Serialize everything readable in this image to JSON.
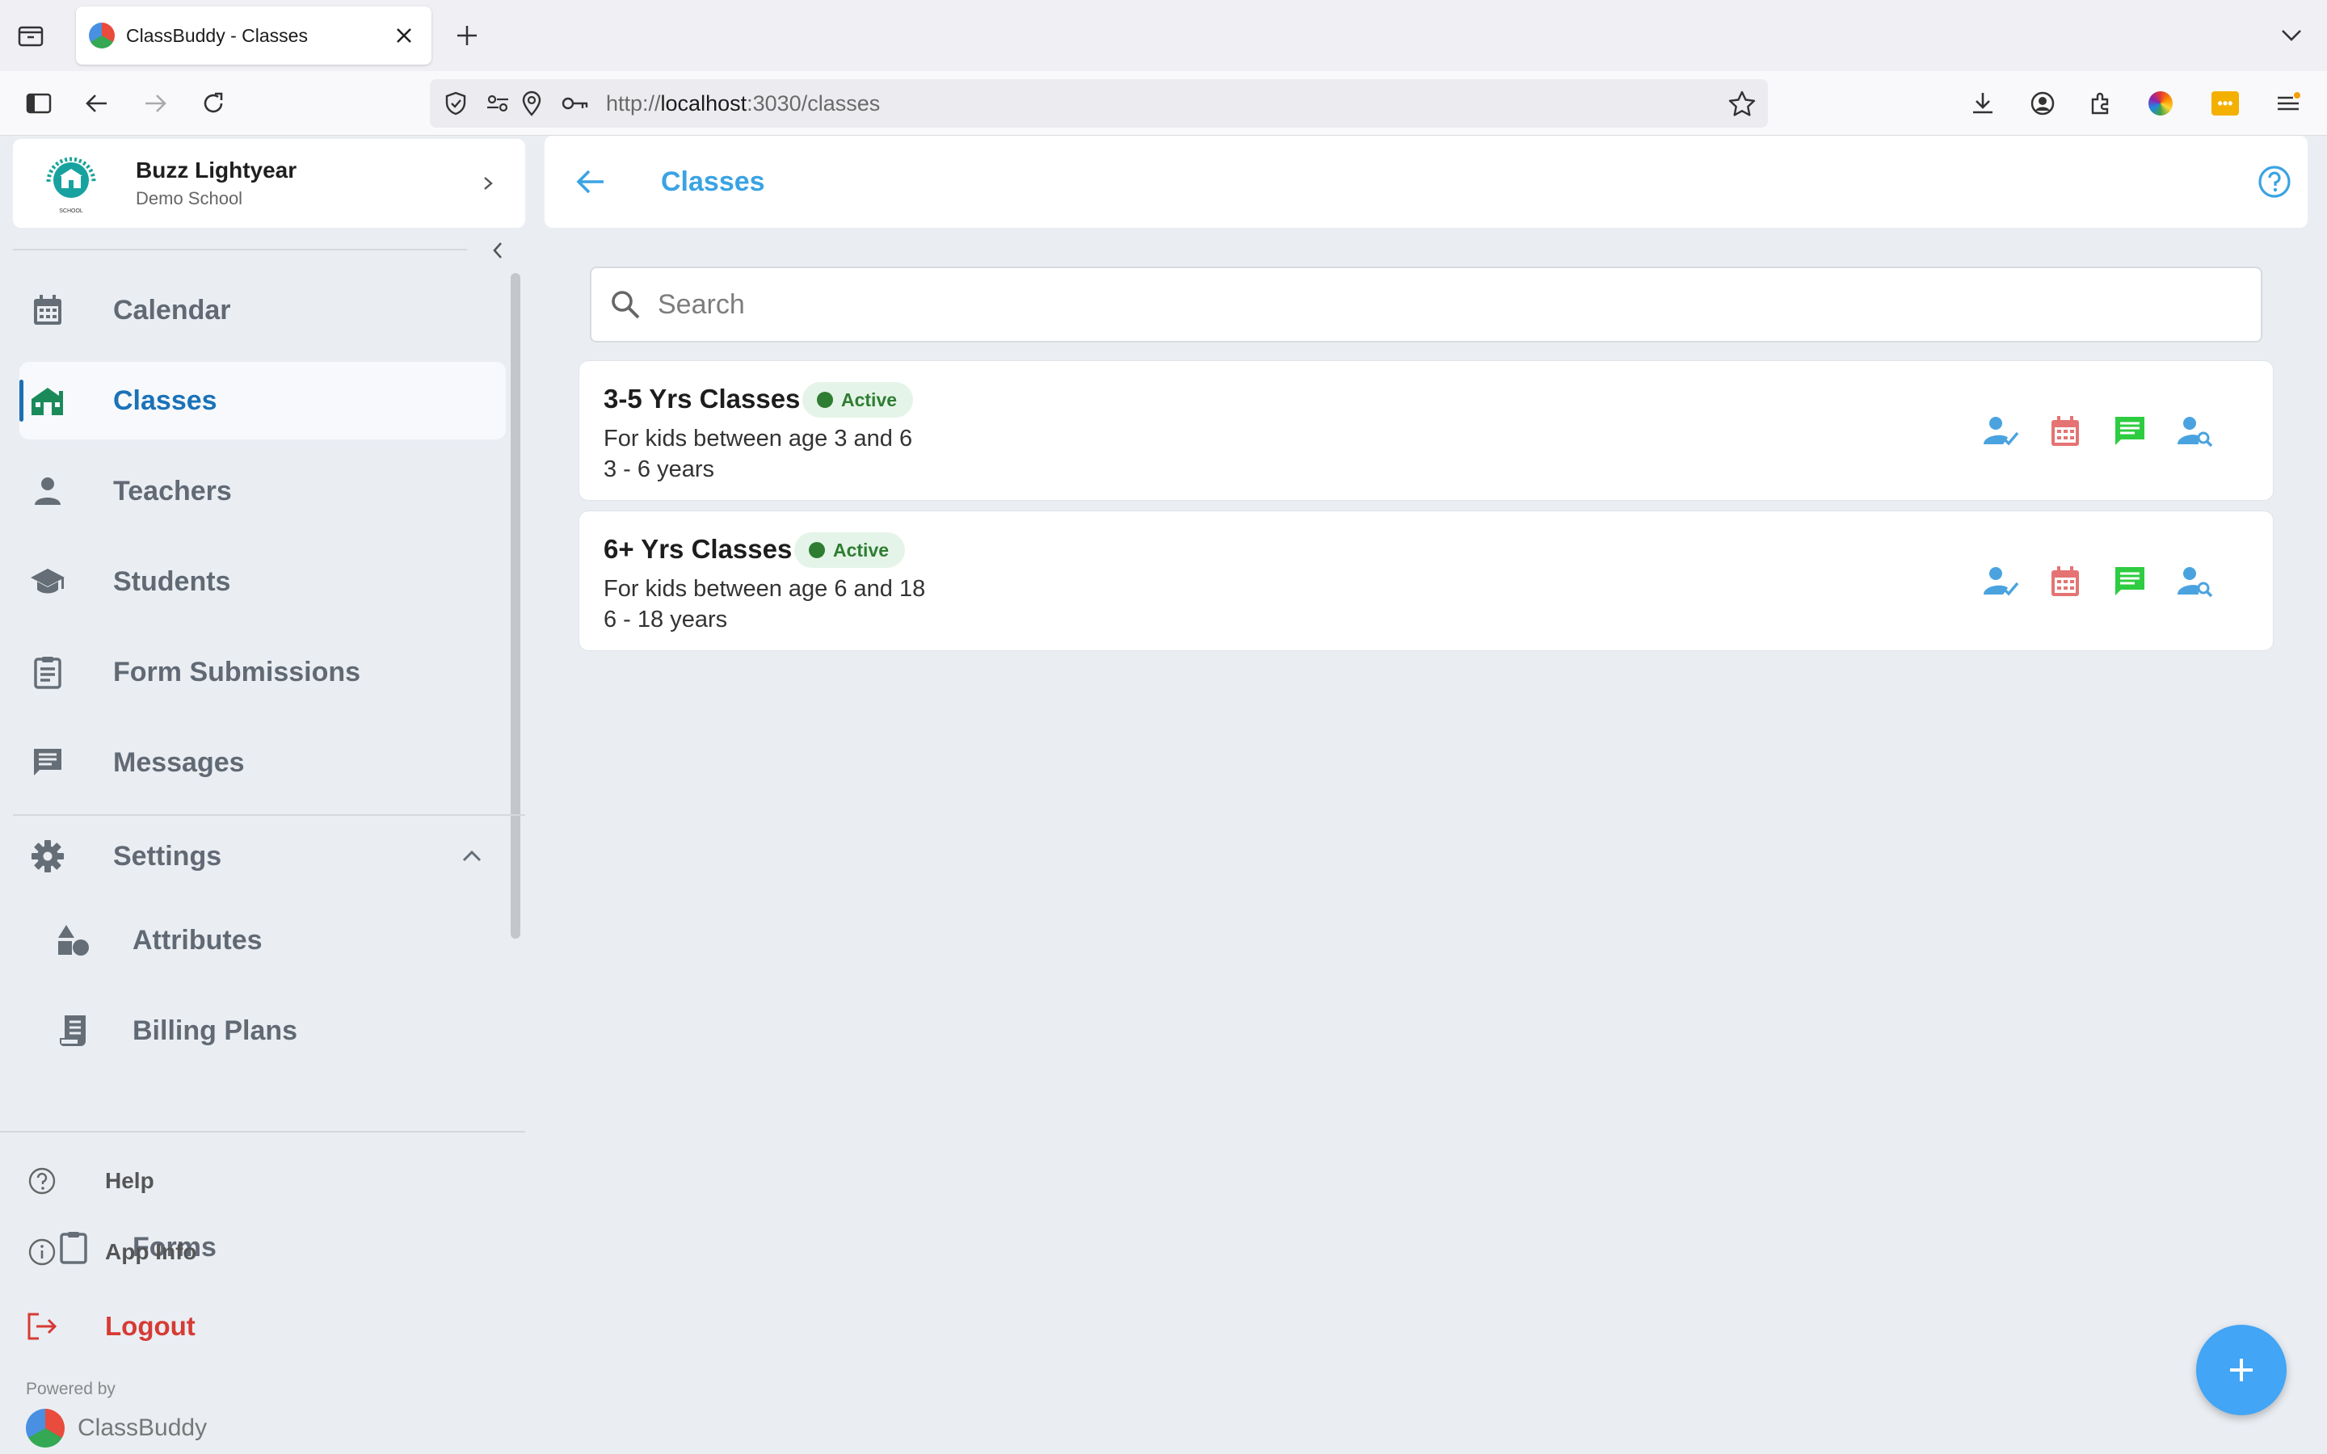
{
  "browser": {
    "tab_title": "ClassBuddy - Classes",
    "url_prefix": "http://",
    "url_host": "localhost",
    "url_path": ":3030/classes"
  },
  "profile": {
    "name": "Buzz Lightyear",
    "school": "Demo School"
  },
  "sidebar": {
    "items": [
      {
        "label": "Calendar",
        "icon": "calendar-icon"
      },
      {
        "label": "Classes",
        "icon": "school-house-icon",
        "active": true
      },
      {
        "label": "Teachers",
        "icon": "person-icon"
      },
      {
        "label": "Students",
        "icon": "graduation-cap-icon"
      },
      {
        "label": "Form Submissions",
        "icon": "clipboard-icon"
      },
      {
        "label": "Messages",
        "icon": "message-icon"
      }
    ],
    "settings": {
      "label": "Settings",
      "expanded": true,
      "subitems": [
        {
          "label": "Attributes",
          "icon": "shapes-icon"
        },
        {
          "label": "Billing Plans",
          "icon": "receipt-icon"
        },
        {
          "label": "Forms",
          "icon": "clipboard-icon"
        }
      ]
    },
    "bottom": {
      "help": "Help",
      "app_info": "App Info",
      "logout": "Logout"
    },
    "powered_by": "Powered by",
    "brand": "ClassBuddy"
  },
  "header": {
    "title": "Classes"
  },
  "search": {
    "placeholder": "Search",
    "value": ""
  },
  "classes": [
    {
      "title": "3-5 Yrs Classes",
      "status": "Active",
      "description": "For kids between age 3 and 6",
      "age_range": "3 - 6 years"
    },
    {
      "title": "6+ Yrs Classes",
      "status": "Active",
      "description": "For kids between age 6 and 18",
      "age_range": "6 - 18 years"
    }
  ],
  "colors": {
    "accent": "#3aa3e3",
    "active_badge": "#2e7d32",
    "calendar_action": "#e57373",
    "message_action": "#2ecc40",
    "logout": "#d63b34",
    "fab": "#42a5f5"
  }
}
